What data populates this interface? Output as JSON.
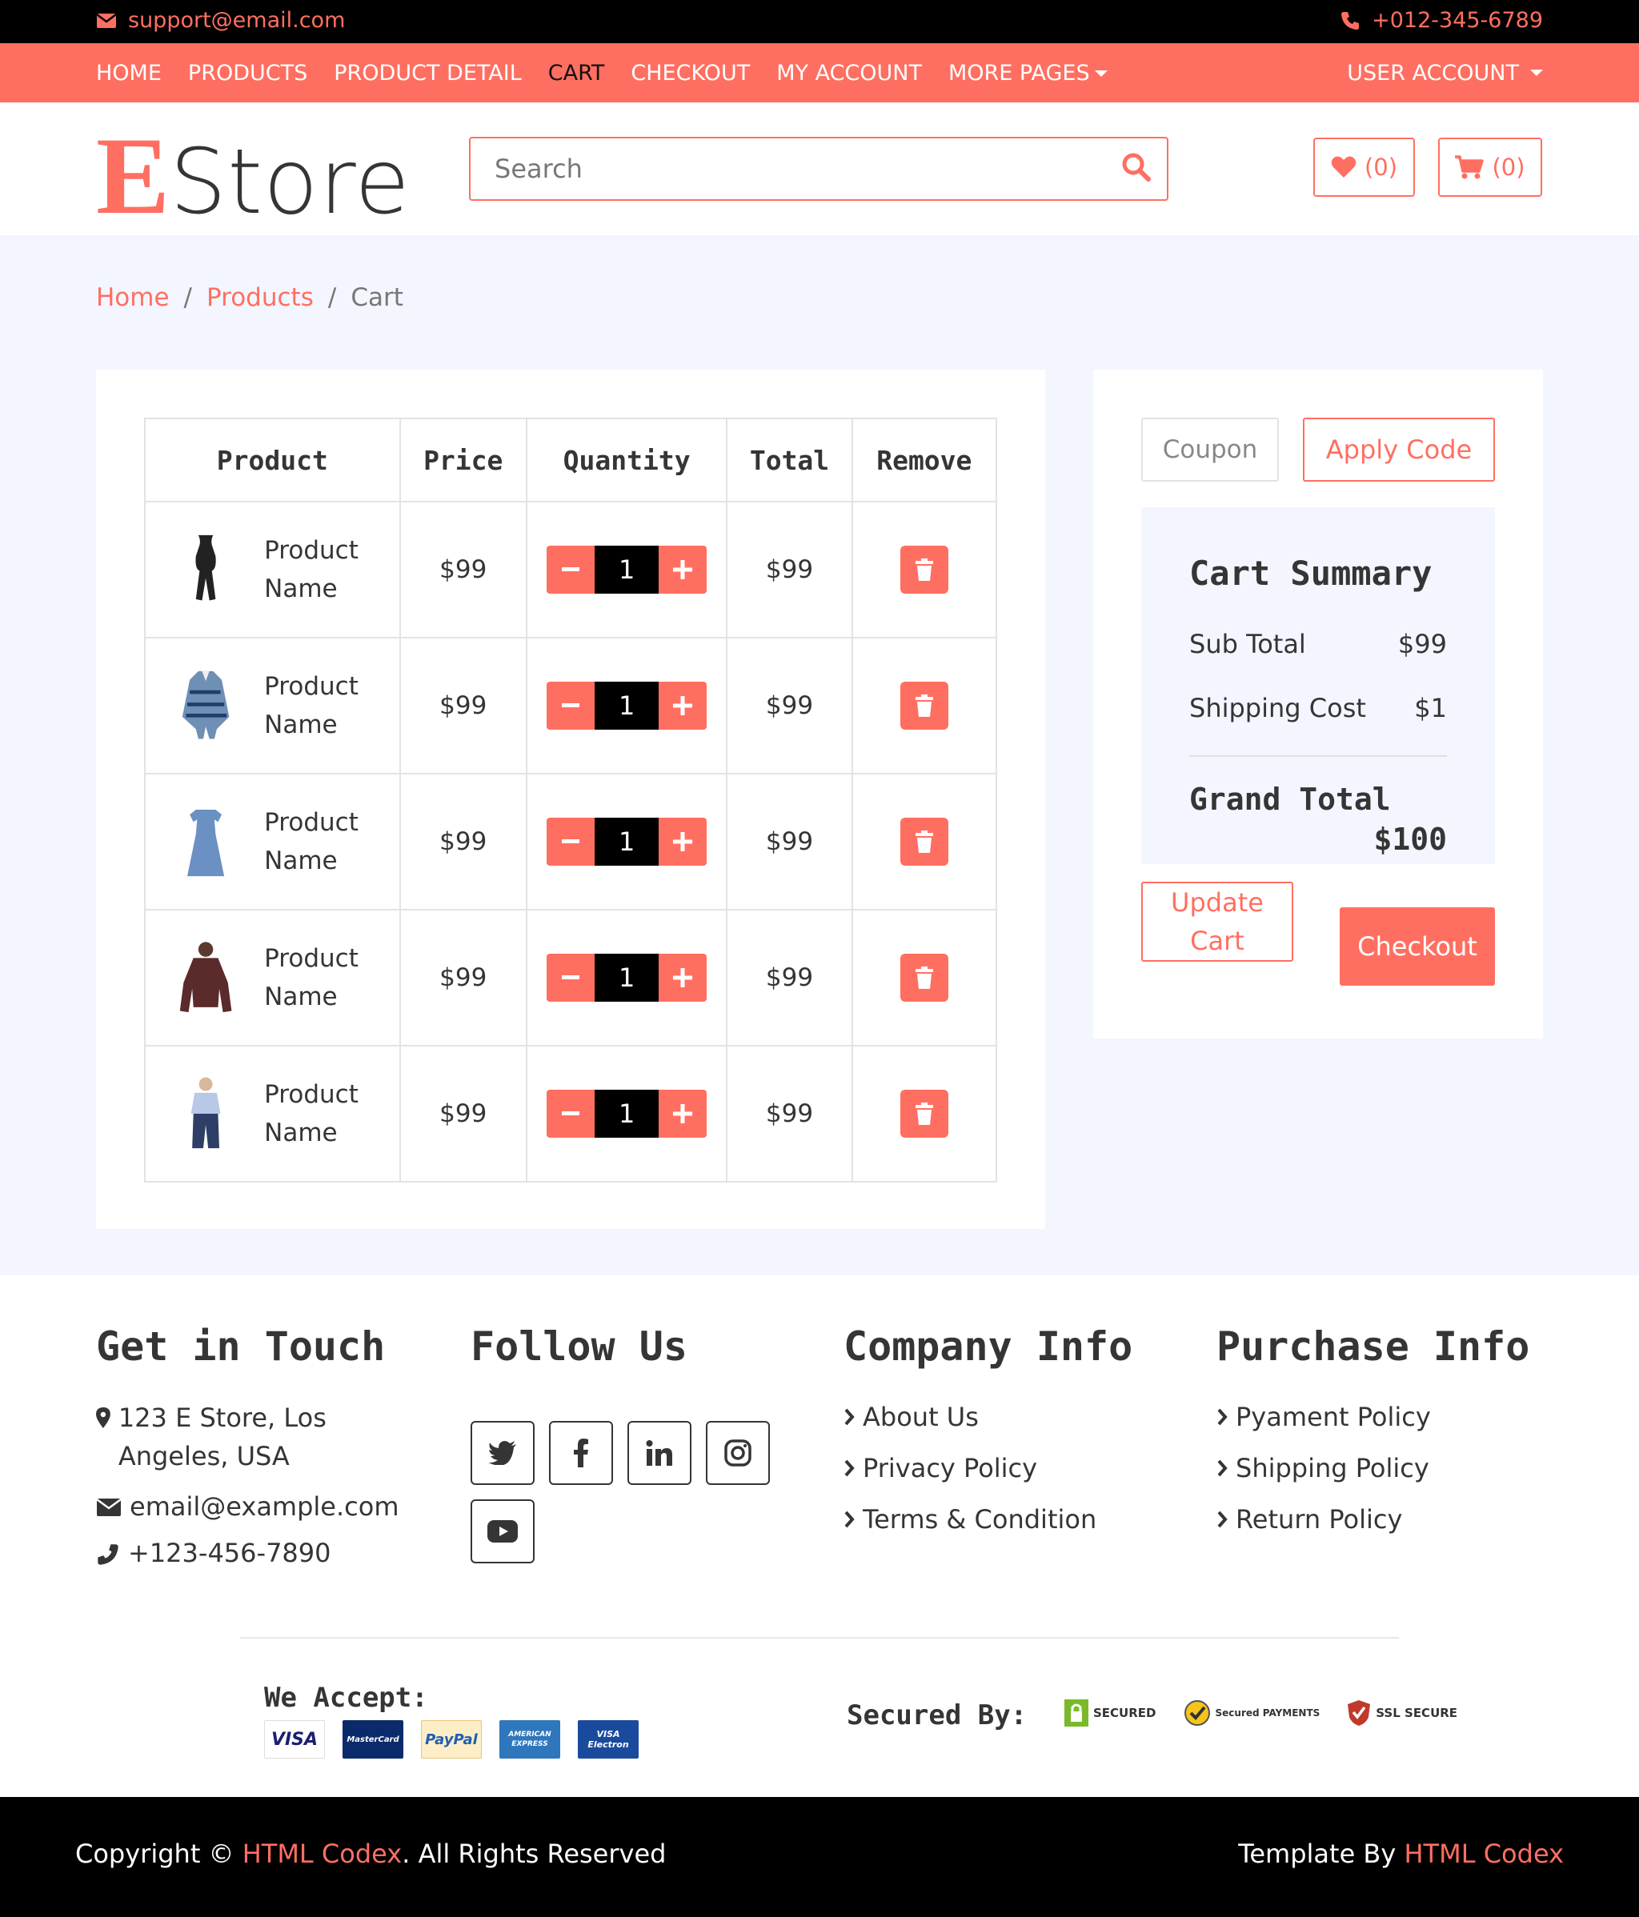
{
  "topbar": {
    "email": "support@email.com",
    "phone": "+012-345-6789"
  },
  "nav": {
    "items": [
      "HOME",
      "PRODUCTS",
      "PRODUCT DETAIL",
      "CART",
      "CHECKOUT",
      "MY ACCOUNT",
      "MORE PAGES"
    ],
    "active": "CART",
    "account": "USER ACCOUNT"
  },
  "header": {
    "logo_initial": "E",
    "logo_rest": "Store",
    "search_placeholder": "Search",
    "wishlist_count": "(0)",
    "cart_count": "(0)"
  },
  "breadcrumb": [
    "Home",
    "Products",
    "Cart"
  ],
  "cart": {
    "columns": [
      "Product",
      "Price",
      "Quantity",
      "Total",
      "Remove"
    ],
    "rows": [
      {
        "name": "Product Name",
        "price": "$99",
        "qty": "1",
        "total": "$99"
      },
      {
        "name": "Product Name",
        "price": "$99",
        "qty": "1",
        "total": "$99"
      },
      {
        "name": "Product Name",
        "price": "$99",
        "qty": "1",
        "total": "$99"
      },
      {
        "name": "Product Name",
        "price": "$99",
        "qty": "1",
        "total": "$99"
      },
      {
        "name": "Product Name",
        "price": "$99",
        "qty": "1",
        "total": "$99"
      }
    ]
  },
  "summary": {
    "coupon_placeholder": "Coupon",
    "apply": "Apply Code",
    "title": "Cart Summary",
    "subtotal_label": "Sub Total",
    "subtotal": "$99",
    "shipping_label": "Shipping Cost",
    "shipping": "$1",
    "grand_label": "Grand Total",
    "grand": "$100",
    "update": "Update Cart",
    "checkout": "Checkout"
  },
  "footer": {
    "touch": {
      "title": "Get in Touch",
      "address": "123 E Store, Los Angeles, USA",
      "email": "email@example.com",
      "phone": "+123-456-7890"
    },
    "follow": {
      "title": "Follow Us"
    },
    "company": {
      "title": "Company Info",
      "links": [
        "About Us",
        "Privacy Policy",
        "Terms & Condition"
      ]
    },
    "purchase": {
      "title": "Purchase Info",
      "links": [
        "Pyament Policy",
        "Shipping Policy",
        "Return Policy"
      ]
    },
    "accept": "We Accept:",
    "secured": "Secured By:",
    "cards": [
      "VISA",
      "MasterCard",
      "PayPal",
      "AMERICAN EXPRESS",
      "VISA Electron"
    ],
    "seals": [
      "SECURED",
      "Secured PAYMENTS",
      "SSL SECURE"
    ]
  },
  "bottom": {
    "copy_prefix": "Copyright ©",
    "brand": "HTML Codex",
    "copy_suffix": ". All Rights Reserved",
    "template_by": "Template By",
    "brand2": "HTML Codex"
  },
  "colors": {
    "accent": "#ff6f61",
    "bg_light": "#f3f6ff",
    "dark": "#000000"
  }
}
